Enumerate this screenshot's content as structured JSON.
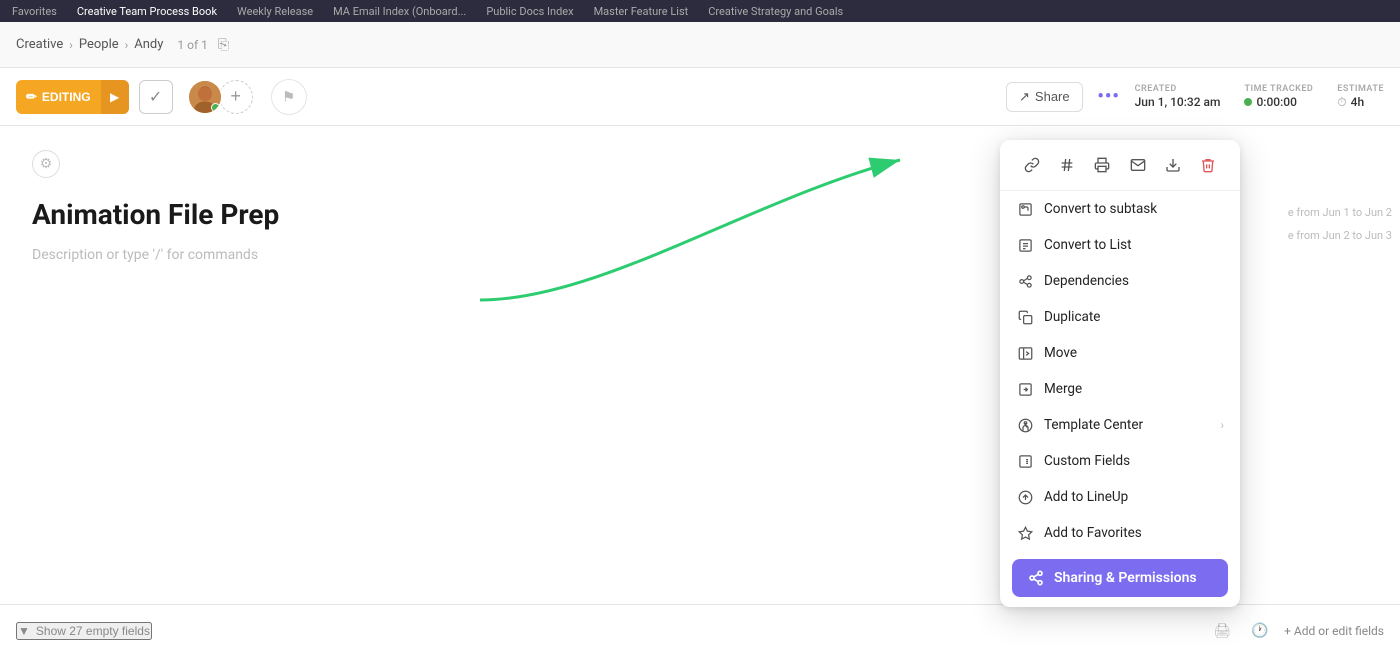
{
  "topNav": {
    "items": [
      {
        "label": "Favorites",
        "active": false
      },
      {
        "label": "Creative Team Process Book",
        "active": false
      },
      {
        "label": "Weekly Release",
        "active": false
      },
      {
        "label": "MA Email Index (Onboard...",
        "active": false
      },
      {
        "label": "Public Docs Index",
        "active": false
      },
      {
        "label": "Master Feature List",
        "active": false
      },
      {
        "label": "Creative Strategy and Goals",
        "active": false
      }
    ]
  },
  "breadcrumb": {
    "items": [
      "Creative",
      "People",
      "Andy"
    ],
    "count": "1 of 1"
  },
  "toolbar": {
    "editing_label": "EDITING",
    "checkmark": "✓",
    "share_label": "Share",
    "more_dots": "•••",
    "created_label": "CREATED",
    "created_value": "Jun 1, 10:32 am",
    "time_tracked_label": "TIME TRACKED",
    "time_tracked_value": "0:00:00",
    "estimate_label": "ESTIMATE",
    "estimate_value": "4h"
  },
  "doc": {
    "title": "Animation File Prep",
    "description": "Description or type '/' for commands",
    "settings_icon": "⚙",
    "side_note_1": "e from Jun 1 to Jun 2",
    "side_note_2": "e from Jun 2 to Jun 3"
  },
  "bottomBar": {
    "show_fields_label": "Show 27 empty fields",
    "add_fields_label": "+ Add or edit fields"
  },
  "dropdown": {
    "icons": [
      {
        "name": "link-icon",
        "symbol": "🔗"
      },
      {
        "name": "hash-icon",
        "symbol": "#"
      },
      {
        "name": "print-icon",
        "symbol": "🖨"
      },
      {
        "name": "mail-icon",
        "symbol": "✉"
      },
      {
        "name": "download-icon",
        "symbol": "⬇"
      },
      {
        "name": "trash-icon",
        "symbol": "🗑",
        "red": true
      }
    ],
    "items": [
      {
        "icon": "subtask-icon",
        "label": "Convert to subtask",
        "symbol": "⤴",
        "arrow": false
      },
      {
        "icon": "list-icon",
        "label": "Convert to List",
        "symbol": "☰",
        "arrow": false
      },
      {
        "icon": "dependency-icon",
        "label": "Dependencies",
        "symbol": "⛓",
        "arrow": false
      },
      {
        "icon": "duplicate-icon",
        "label": "Duplicate",
        "symbol": "⧉",
        "arrow": false
      },
      {
        "icon": "move-icon",
        "label": "Move",
        "symbol": "↗",
        "arrow": false
      },
      {
        "icon": "merge-icon",
        "label": "Merge",
        "symbol": "⊕",
        "arrow": false
      },
      {
        "icon": "template-icon",
        "label": "Template Center",
        "symbol": "✦",
        "arrow": true
      },
      {
        "icon": "custom-fields-icon",
        "label": "Custom Fields",
        "symbol": "✎",
        "arrow": false
      },
      {
        "icon": "lineup-icon",
        "label": "Add to LineUp",
        "symbol": "↑",
        "arrow": false
      },
      {
        "icon": "favorites-icon",
        "label": "Add to Favorites",
        "symbol": "★",
        "arrow": false
      }
    ],
    "sharing_label": "Sharing & Permissions",
    "sharing_symbol": "⇄"
  }
}
